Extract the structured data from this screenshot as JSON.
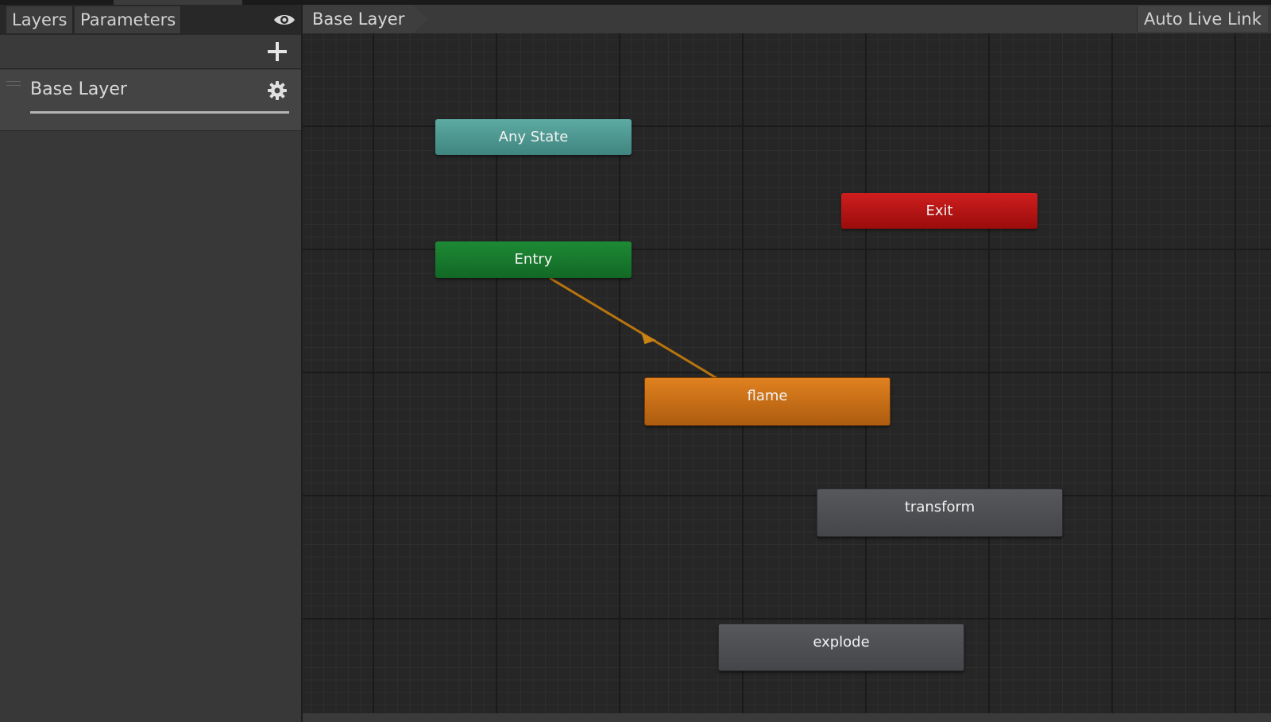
{
  "left_panel": {
    "tabs": [
      {
        "label": "Layers"
      },
      {
        "label": "Parameters"
      }
    ],
    "layers": [
      {
        "name": "Base Layer"
      }
    ]
  },
  "breadcrumb": {
    "current": "Base Layer"
  },
  "toolbar": {
    "auto_live_link_label": "Auto Live Link"
  },
  "graph": {
    "nodes": {
      "any_state": "Any State",
      "exit": "Exit",
      "entry": "Entry",
      "flame": "flame",
      "transform": "transform",
      "explode": "explode"
    },
    "transitions": [
      {
        "from": "Entry",
        "to": "flame",
        "color": "#b8740e"
      }
    ]
  },
  "colors": {
    "any_state": "#4d9a93",
    "exit": "#b51616",
    "entry": "#18792d",
    "default_state": "#e0811f",
    "state": "#4e4f53"
  },
  "icons": {
    "visibility": "eye-icon",
    "add": "plus-icon",
    "settings": "gear-icon"
  }
}
